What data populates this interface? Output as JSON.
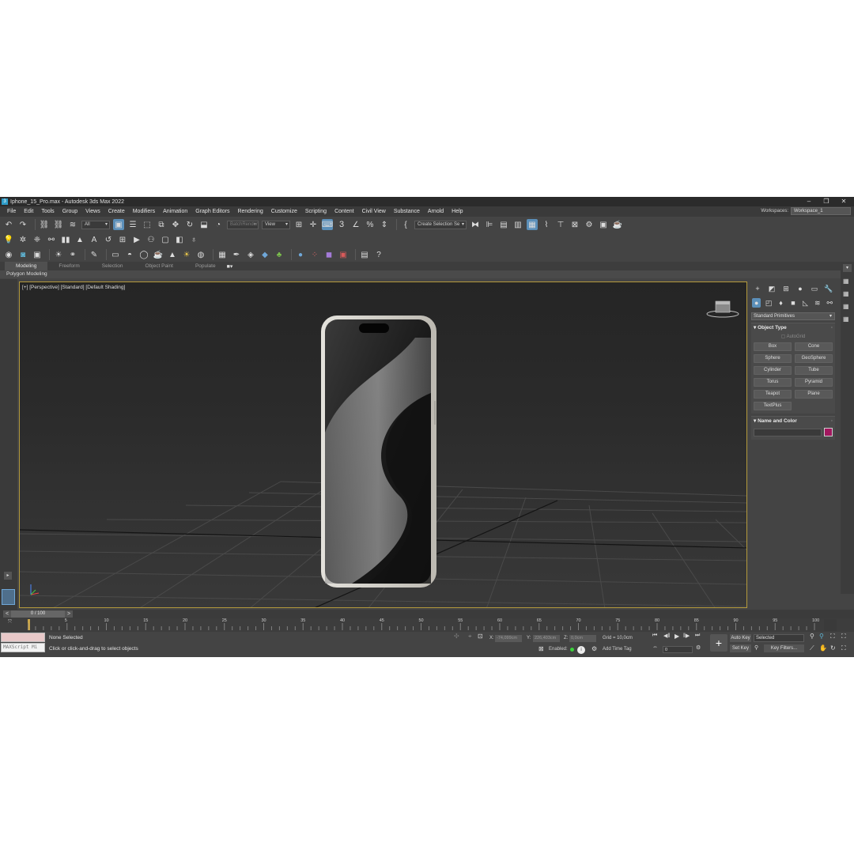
{
  "window": {
    "title": "Iphone_15_Pro.max - Autodesk 3ds Max 2022",
    "app_icon": "3",
    "minimize": "–",
    "maximize": "❐",
    "close": "✕"
  },
  "menu": [
    "File",
    "Edit",
    "Tools",
    "Group",
    "Views",
    "Create",
    "Modifiers",
    "Animation",
    "Graph Editors",
    "Rendering",
    "Customize",
    "Scripting",
    "Content",
    "Civil View",
    "Substance",
    "Arnold",
    "Help"
  ],
  "workspaces": {
    "label": "Workspaces:",
    "value": "Workspace_1"
  },
  "toolbar": {
    "filter_combo": "All",
    "batch_render": "BatchRender",
    "ref_coord": "View",
    "selection_set": "Create Selection Se",
    "snap_3": "3"
  },
  "ribbon": {
    "tabs": [
      "Modeling",
      "Freeform",
      "Selection",
      "Object Paint",
      "Populate"
    ],
    "panel_label": "Polygon Modeling"
  },
  "viewport": {
    "label": "[+] [Perspective] [Standard] [Default Shading]"
  },
  "command_panel": {
    "primitives_combo": "Standard Primitives",
    "object_type_title": "Object Type",
    "autogrid": "AutoGrid",
    "buttons": [
      "Box",
      "Cone",
      "Sphere",
      "GeoSphere",
      "Cylinder",
      "Tube",
      "Torus",
      "Pyramid",
      "Teapot",
      "Plane",
      "TextPlus"
    ],
    "name_color_title": "Name and Color",
    "object_color": "#a3175f"
  },
  "timeline": {
    "frame": "0 / 100",
    "prev": "<",
    "next": ">",
    "ticks": [
      "5",
      "10",
      "15",
      "20",
      "25",
      "30",
      "35",
      "40",
      "45",
      "50",
      "55",
      "60",
      "65",
      "70",
      "75",
      "80",
      "85",
      "90",
      "95",
      "100"
    ]
  },
  "status": {
    "maxscript": "MAXScript Mi",
    "selection": "None Selected",
    "prompt": "Click or click-and-drag to select objects",
    "x_label": "X:",
    "x_value": "-74,099cm",
    "y_label": "Y:",
    "y_value": "226,403cm",
    "z_label": "Z:",
    "z_value": "0,0cm",
    "grid": "Grid = 10,0cm",
    "enabled": "Enabled:",
    "add_time_tag": "Add Time Tag",
    "auto_key": "Auto Key",
    "set_key": "Set Key",
    "key_mode": "Selected",
    "key_filters": "Key Filters...",
    "frame_field": "0"
  }
}
